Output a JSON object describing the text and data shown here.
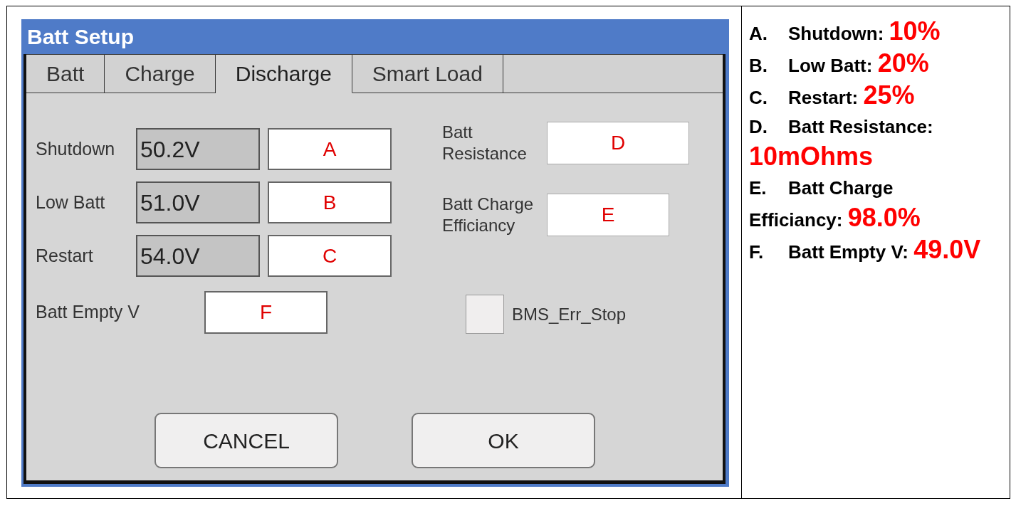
{
  "window": {
    "title": "Batt Setup"
  },
  "tabs": [
    {
      "label": "Batt",
      "selected": false
    },
    {
      "label": "Charge",
      "selected": false
    },
    {
      "label": "Discharge",
      "selected": true
    },
    {
      "label": "Smart Load",
      "selected": false
    }
  ],
  "voltage_rows": [
    {
      "label": "Shutdown",
      "current": "50.2V",
      "value": "A"
    },
    {
      "label": "Low Batt",
      "current": "51.0V",
      "value": "B"
    },
    {
      "label": "Restart",
      "current": "54.0V",
      "value": "C"
    }
  ],
  "batt_empty_v": {
    "label": "Batt Empty V",
    "value": "F"
  },
  "battery_params": [
    {
      "label": "Batt Resistance",
      "value": "D"
    },
    {
      "label": "Batt Charge Efficiancy",
      "value": "E"
    }
  ],
  "bms_err_stop": {
    "label": "BMS_Err_Stop",
    "checked": false
  },
  "buttons": [
    "CANCEL",
    "OK"
  ],
  "notes": [
    {
      "letter": "A.",
      "label": "Shutdown:",
      "value": "10%"
    },
    {
      "letter": "B.",
      "label": "Low Batt:",
      "value": "20%"
    },
    {
      "letter": "C.",
      "label": "Restart:",
      "value": "25%"
    },
    {
      "letter": "D.",
      "label": "Batt Resistance:",
      "value": "10mOhms"
    },
    {
      "letter": "E.",
      "label": "Batt Charge Efficiancy:",
      "value": "98.0%"
    },
    {
      "letter": "F.",
      "label": "Batt Empty V:",
      "value": "49.0V"
    }
  ]
}
